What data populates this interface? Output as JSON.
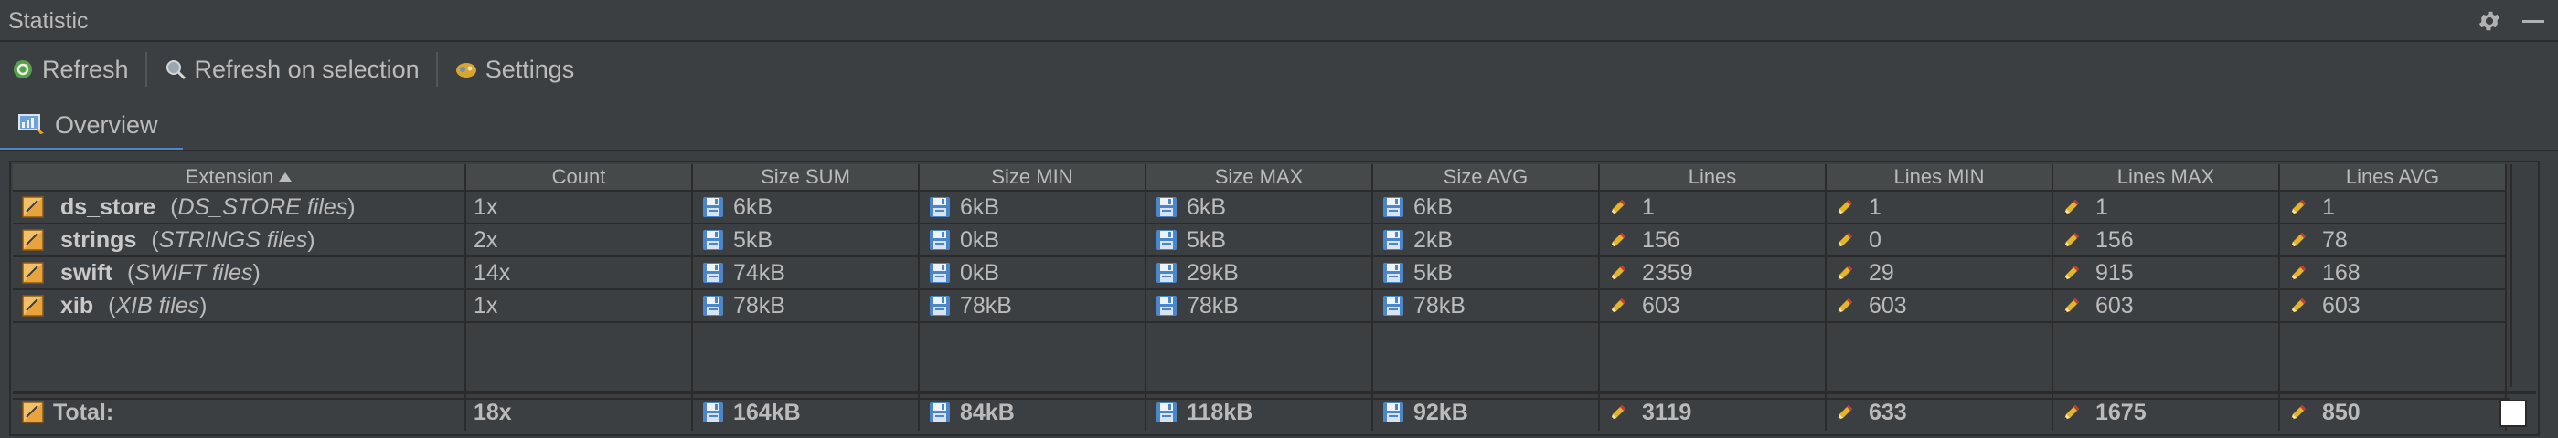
{
  "window": {
    "title": "Statistic",
    "icons": [
      "gear-icon",
      "minimize-icon"
    ]
  },
  "toolbar": {
    "refresh_label": "Refresh",
    "refresh_selection_label": "Refresh on selection",
    "settings_label": "Settings",
    "icons": [
      "refresh-icon",
      "refresh-on-selection-icon",
      "settings-icon"
    ]
  },
  "tabs": [
    {
      "label": "Overview",
      "icon": "overview-icon",
      "selected": true
    }
  ],
  "table": {
    "columns": [
      "Extension",
      "Count",
      "Size SUM",
      "Size MIN",
      "Size MAX",
      "Size AVG",
      "Lines",
      "Lines MIN",
      "Lines MAX",
      "Lines AVG"
    ],
    "sort": {
      "column": "Extension",
      "direction": "ascending"
    },
    "rows": [
      {
        "name": "ds_store",
        "desc": "DS_STORE files",
        "count": "1x",
        "size_sum": "6kB",
        "size_min": "6kB",
        "size_max": "6kB",
        "size_avg": "6kB",
        "lines": "1",
        "lines_min": "1",
        "lines_max": "1",
        "lines_avg": "1"
      },
      {
        "name": "strings",
        "desc": "STRINGS files",
        "count": "2x",
        "size_sum": "5kB",
        "size_min": "0kB",
        "size_max": "5kB",
        "size_avg": "2kB",
        "lines": "156",
        "lines_min": "0",
        "lines_max": "156",
        "lines_avg": "78"
      },
      {
        "name": "swift",
        "desc": "SWIFT files",
        "count": "14x",
        "size_sum": "74kB",
        "size_min": "0kB",
        "size_max": "29kB",
        "size_avg": "5kB",
        "lines": "2359",
        "lines_min": "29",
        "lines_max": "915",
        "lines_avg": "168"
      },
      {
        "name": "xib",
        "desc": "XIB files",
        "count": "1x",
        "size_sum": "78kB",
        "size_min": "78kB",
        "size_max": "78kB",
        "size_avg": "78kB",
        "lines": "603",
        "lines_min": "603",
        "lines_max": "603",
        "lines_avg": "603"
      }
    ],
    "totals": {
      "label": "Total:",
      "count": "18x",
      "size_sum": "164kB",
      "size_min": "84kB",
      "size_max": "118kB",
      "size_avg": "92kB",
      "lines": "3119",
      "lines_min": "633",
      "lines_max": "1675",
      "lines_avg": "850"
    }
  },
  "colors": {
    "background": "#3c3f41",
    "header": "#45494a",
    "grid": "#2b2b2b",
    "text": "#bbbbbb",
    "accent": "#4a88c7",
    "file_icon": "#e8a33c",
    "disk_icon": "#4a86c8",
    "pencil_icon": "#e4b429"
  },
  "cell_icons": {
    "extension": "file-type-icon",
    "size": "floppy-disk-icon",
    "lines": "pencil-icon"
  }
}
